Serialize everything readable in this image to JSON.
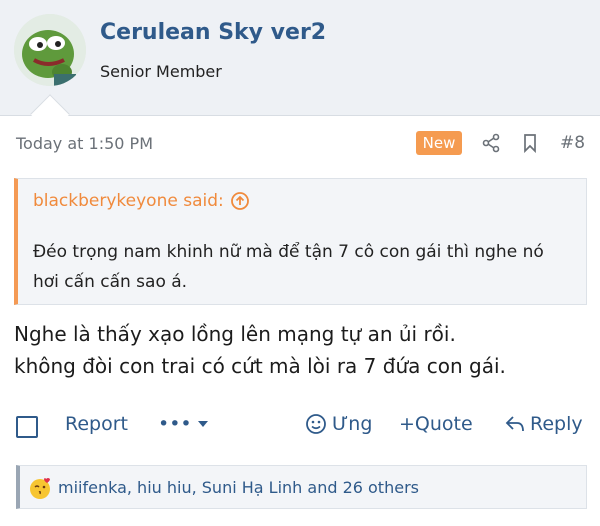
{
  "user": {
    "name": "Cerulean Sky ver2",
    "title": "Senior Member",
    "avatar_icon": "pepe-frog-avatar"
  },
  "post": {
    "timestamp": "Today at 1:50 PM",
    "badge": "New",
    "number": "#8"
  },
  "quote": {
    "author_line": "blackberykeyone said:",
    "text": "Đéo trọng nam khinh nữ mà để tận 7 cô con gái thì nghe nó hơi cấn cấn sao á."
  },
  "message": {
    "line1": "Nghe là thấy xạo lồng lên mạng tự an ủi rồi.",
    "line2": "không đòi con trai có cứt mà lòi ra 7 đứa con gái."
  },
  "actions": {
    "report": "Report",
    "more": "•••",
    "react": "Ưng",
    "quote": "+Quote",
    "reply": "Reply"
  },
  "reactions": {
    "text": "miifenka, hiu hiu, Suni Hạ Linh and 26 others"
  },
  "colors": {
    "accent": "#2f5a8a",
    "badge": "#f59b50",
    "quote_bar": "#f49a55"
  }
}
